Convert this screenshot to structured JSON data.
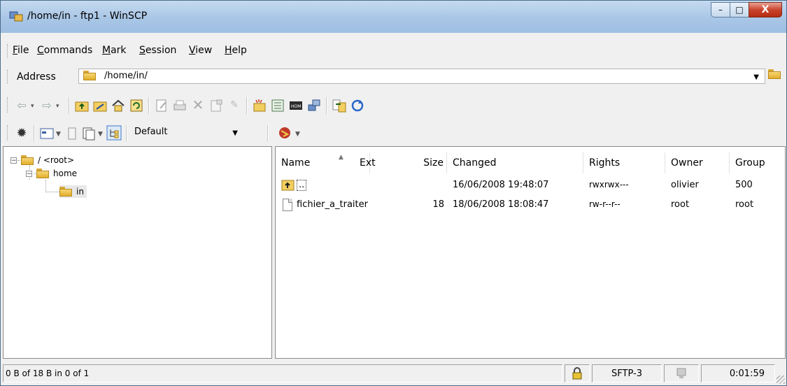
{
  "window": {
    "title": "/home/in - ftp1 - WinSCP",
    "minimize_glyph": "–",
    "maximize_glyph": "□",
    "close_glyph": "X"
  },
  "menu": {
    "items": [
      "File",
      "Commands",
      "Mark",
      "Session",
      "View",
      "Help"
    ]
  },
  "address": {
    "label": "Address",
    "path": "/home/in/"
  },
  "toolbar2": {
    "session_combo": "Default"
  },
  "tree": {
    "nodes": [
      "/ <root>",
      "home",
      "in"
    ]
  },
  "file_list": {
    "columns": [
      "Name",
      "Ext",
      "Size",
      "Changed",
      "Rights",
      "Owner",
      "Group"
    ],
    "rows": [
      {
        "name": "..",
        "ext": "",
        "size": "",
        "changed": "16/06/2008 19:48:07",
        "rights": "rwxrwx---",
        "owner": "olivier",
        "group": "500",
        "icon": "parent-dir-icon"
      },
      {
        "name": "fichier_a_traiter",
        "ext": "",
        "size": "18",
        "changed": "18/06/2008 18:08:47",
        "rights": "rw-r--r--",
        "owner": "root",
        "group": "root",
        "icon": "file-icon"
      }
    ]
  },
  "status": {
    "selection": "0 B of 18 B in 0 of 1",
    "protocol": "SFTP-3",
    "elapsed": "0:01:59"
  },
  "colors": {
    "titlebar": "#a9c6e6",
    "close_button": "#c9452d",
    "folder": "#e2ae2c"
  }
}
